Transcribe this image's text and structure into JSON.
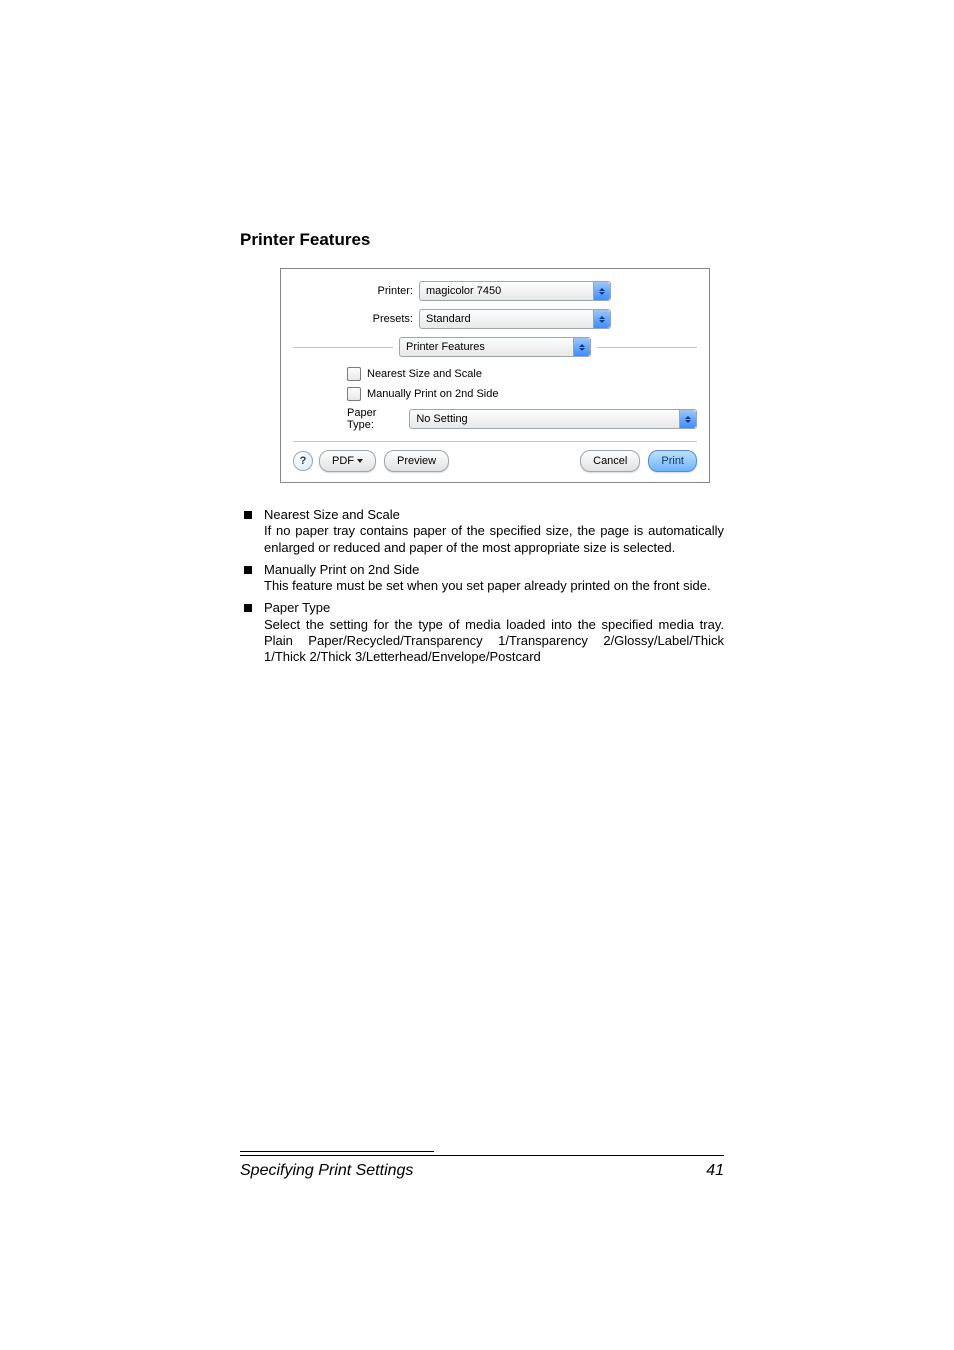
{
  "heading": "Printer Features",
  "dialog": {
    "labels": {
      "printer": "Printer:",
      "presets": "Presets:",
      "paper_type": "Paper Type:"
    },
    "printer": "magicolor 7450",
    "presets": "Standard",
    "section": "Printer Features",
    "checkboxes": {
      "nearest": "Nearest Size and Scale",
      "side2": "Manually Print on 2nd Side"
    },
    "paper_type_value": "No Setting",
    "buttons": {
      "help": "?",
      "pdf": "PDF",
      "preview": "Preview",
      "cancel": "Cancel",
      "print": "Print"
    }
  },
  "items": [
    {
      "title": "Nearest Size and Scale",
      "desc": "If no paper tray contains paper of the specified size, the page is automatically enlarged or reduced and paper of the most appropriate size is selected."
    },
    {
      "title": "Manually Print on 2nd Side",
      "desc": "This feature must be set when you set paper already printed on the front side."
    },
    {
      "title": "Paper Type",
      "desc": "Select the setting for the type of media loaded into the specified media tray.\nPlain Paper/Recycled/Transparency 1/Transparency 2/Glossy/Label/Thick 1/Thick 2/Thick 3/Letterhead/Envelope/Postcard"
    }
  ],
  "footer": {
    "left": "Specifying Print Settings",
    "page": "41"
  }
}
